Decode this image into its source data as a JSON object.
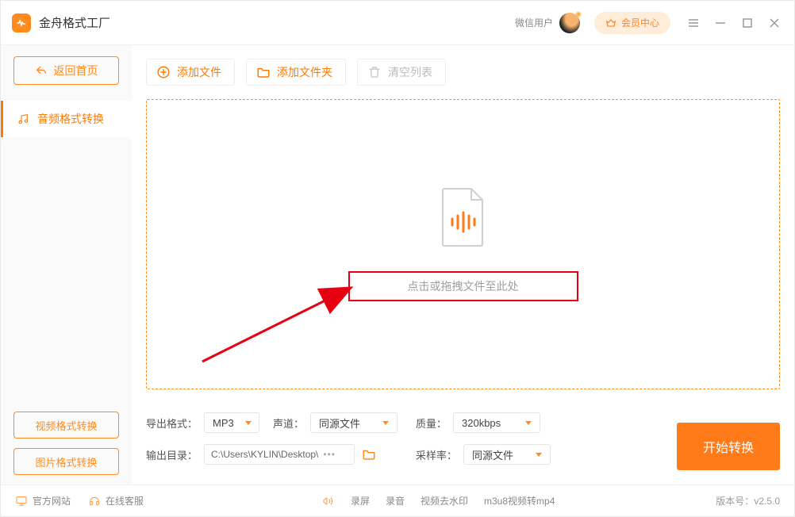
{
  "title": "金舟格式工厂",
  "header": {
    "user_label": "微信用户",
    "member_label": "会员中心"
  },
  "sidebar": {
    "back_label": "返回首页",
    "items": [
      {
        "label": "音频格式转换"
      }
    ],
    "video_btn": "视频格式转换",
    "image_btn": "图片格式转换"
  },
  "toolbar": {
    "add_file": "添加文件",
    "add_folder": "添加文件夹",
    "clear_list": "清空列表"
  },
  "dropzone": {
    "hint": "点击或拖拽文件至此处"
  },
  "settings": {
    "export_format_label": "导出格式：",
    "export_format_value": "MP3",
    "channel_label": "声道：",
    "channel_value": "同源文件",
    "quality_label": "质量：",
    "quality_value": "320kbps",
    "sample_label": "采样率：",
    "sample_value": "同源文件",
    "output_dir_label": "输出目录：",
    "output_dir_value": "C:\\Users\\KYLIN\\Desktop\\"
  },
  "convert_label": "开始转换",
  "footer": {
    "official_site": "官方网站",
    "online_service": "在线客服",
    "record_screen": "录屏",
    "record_audio": "录音",
    "remove_watermark": "视频去水印",
    "m3u8": "m3u8视频转mp4",
    "version_prefix": "版本号：",
    "version": "v2.5.0"
  }
}
